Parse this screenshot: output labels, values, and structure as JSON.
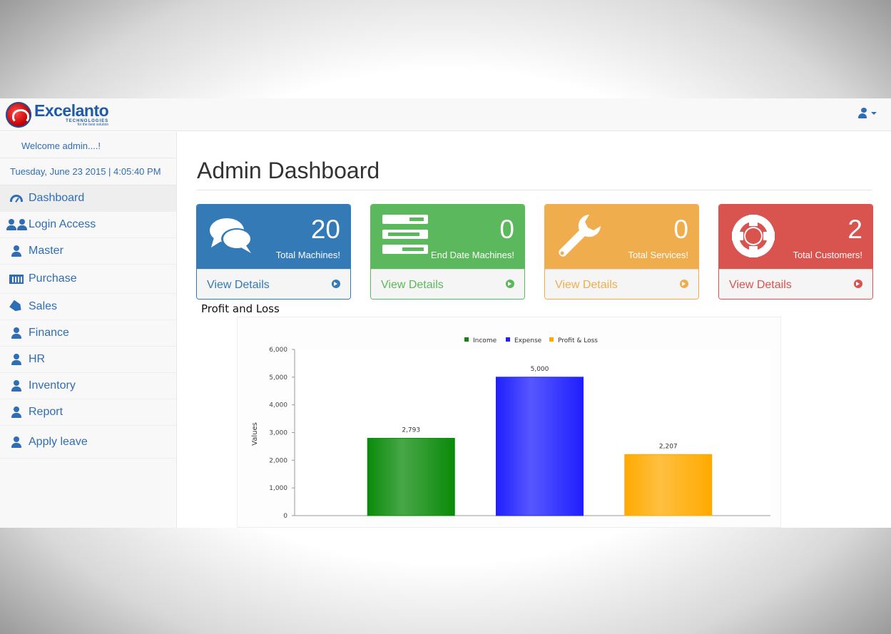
{
  "brand": {
    "name": "Excelanto",
    "sub": "TECHNOLOGIES",
    "tagline": "for the best solution"
  },
  "sidebar": {
    "welcome": "Welcome admin....!",
    "datetime": "Tuesday, June 23 2015 | 4:05:40 PM",
    "items": [
      {
        "label": "Dashboard",
        "icon": "dashboard-icon"
      },
      {
        "label": "Login Access",
        "icon": "users-icon"
      },
      {
        "label": "Master",
        "icon": "user-icon"
      },
      {
        "label": "Purchase",
        "icon": "cart-icon"
      },
      {
        "label": "Sales",
        "icon": "tags-icon"
      },
      {
        "label": "Finance",
        "icon": "user-icon"
      },
      {
        "label": "HR",
        "icon": "user-icon"
      },
      {
        "label": "Inventory",
        "icon": "user-icon"
      },
      {
        "label": "Report",
        "icon": "user-icon"
      },
      {
        "label": "Apply leave",
        "icon": "user-icon"
      }
    ]
  },
  "main": {
    "title": "Admin Dashboard",
    "panels": [
      {
        "value": "20",
        "label": "Total Machines!",
        "link": "View Details",
        "icon": "comments-icon",
        "color": "#337ab7"
      },
      {
        "value": "0",
        "label": "End Date Machines!",
        "link": "View Details",
        "icon": "tasks-icon",
        "color": "#5cb85c"
      },
      {
        "value": "0",
        "label": "Total Services!",
        "link": "View Details",
        "icon": "wrench-icon",
        "color": "#f0ad4e"
      },
      {
        "value": "2",
        "label": "Total Customers!",
        "link": "View Details",
        "icon": "support-icon",
        "color": "#d9534f"
      }
    ],
    "chart_title": "Profit and Loss"
  },
  "chart_data": {
    "type": "bar",
    "categories": [
      "Income",
      "Expense",
      "Profit & Loss"
    ],
    "values": [
      2793,
      5000,
      2207
    ],
    "value_labels": [
      "2,793",
      "5,000",
      "2,207"
    ],
    "colors": [
      "#0a8a0a",
      "#1f1fff",
      "#ffaa00"
    ],
    "legend": [
      "Income",
      "Expense",
      "Profit & Loss"
    ],
    "legend_position": "top-center",
    "ylabel": "Values",
    "xlabel": "",
    "ylim": [
      0,
      6000
    ],
    "yticks": [
      "0",
      "1,000",
      "2,000",
      "3,000",
      "4,000",
      "5,000",
      "6,000"
    ],
    "ytick_values": [
      0,
      1000,
      2000,
      3000,
      4000,
      5000,
      6000
    ],
    "grid": false
  }
}
